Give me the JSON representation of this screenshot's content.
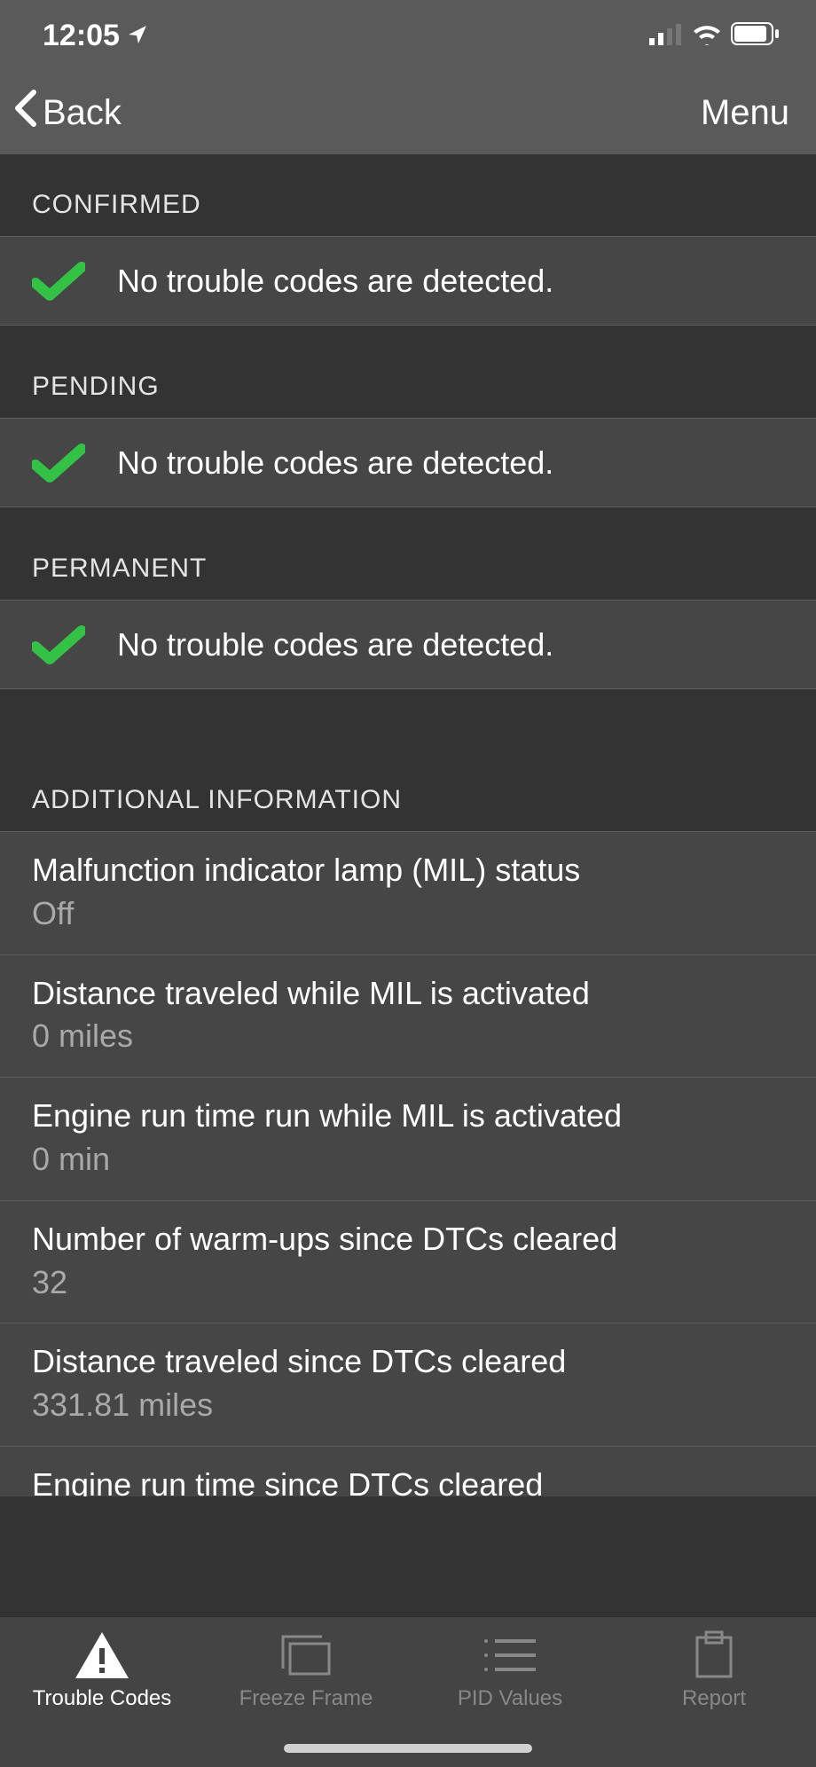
{
  "statusBar": {
    "time": "12:05"
  },
  "nav": {
    "back": "Back",
    "menu": "Menu"
  },
  "sections": {
    "confirmed": {
      "title": "CONFIRMED",
      "message": "No trouble codes are detected."
    },
    "pending": {
      "title": "PENDING",
      "message": "No trouble codes are detected."
    },
    "permanent": {
      "title": "PERMANENT",
      "message": "No trouble codes are detected."
    }
  },
  "additional": {
    "title": "ADDITIONAL INFORMATION",
    "rows": [
      {
        "label": "Malfunction indicator lamp (MIL) status",
        "value": "Off"
      },
      {
        "label": "Distance traveled while MIL is activated",
        "value": "0 miles"
      },
      {
        "label": "Engine run time run while MIL is activated",
        "value": "0 min"
      },
      {
        "label": "Number of warm-ups since DTCs cleared",
        "value": "32"
      },
      {
        "label": "Distance traveled since DTCs cleared",
        "value": "331.81 miles"
      },
      {
        "label": "Engine run time since DTCs cleared",
        "value": ""
      }
    ]
  },
  "tabs": {
    "troubleCodes": "Trouble Codes",
    "freezeFrame": "Freeze Frame",
    "pidValues": "PID Values",
    "report": "Report"
  }
}
